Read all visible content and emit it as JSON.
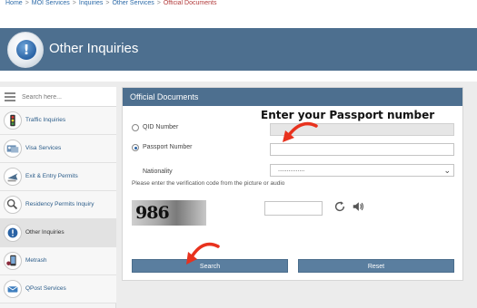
{
  "breadcrumb": {
    "items": [
      "Home",
      "MOI Services",
      "Inquiries",
      "Other Services"
    ],
    "current": "Official Documents"
  },
  "banner": {
    "title": "Other Inquiries",
    "icon": "info-exclamation-icon"
  },
  "sidebar": {
    "search_placeholder": "Search here...",
    "items": [
      {
        "label": "Traffic Inquiries",
        "icon": "traffic-light-icon"
      },
      {
        "label": "Visa Services",
        "icon": "visa-icon"
      },
      {
        "label": "Exit & Entry Permits",
        "icon": "airplane-icon"
      },
      {
        "label": "Residency Permits Inquiry",
        "icon": "residency-icon"
      },
      {
        "label": "Other Inquiries",
        "icon": "info-icon"
      },
      {
        "label": "Metrash",
        "icon": "metrash-phone-icon"
      },
      {
        "label": "QPost Services",
        "icon": "qpost-icon"
      }
    ]
  },
  "panel": {
    "title": "Official Documents",
    "qid_label": "QID Number",
    "passport_label": "Passport Number",
    "nationality_label": "Nationality",
    "nationality_value": "...............",
    "verification_note": "Please enter the verification code from the picture or audio",
    "captcha_text": "986",
    "search_label": "Search",
    "reset_label": "Reset",
    "selected_option": "passport"
  },
  "annotation": {
    "text": "Enter your Passport number",
    "arrow_color": "#e8321e"
  },
  "colors": {
    "banner": "#4d6f8f",
    "button": "#5a7e9f",
    "link": "#2c5d8a"
  }
}
